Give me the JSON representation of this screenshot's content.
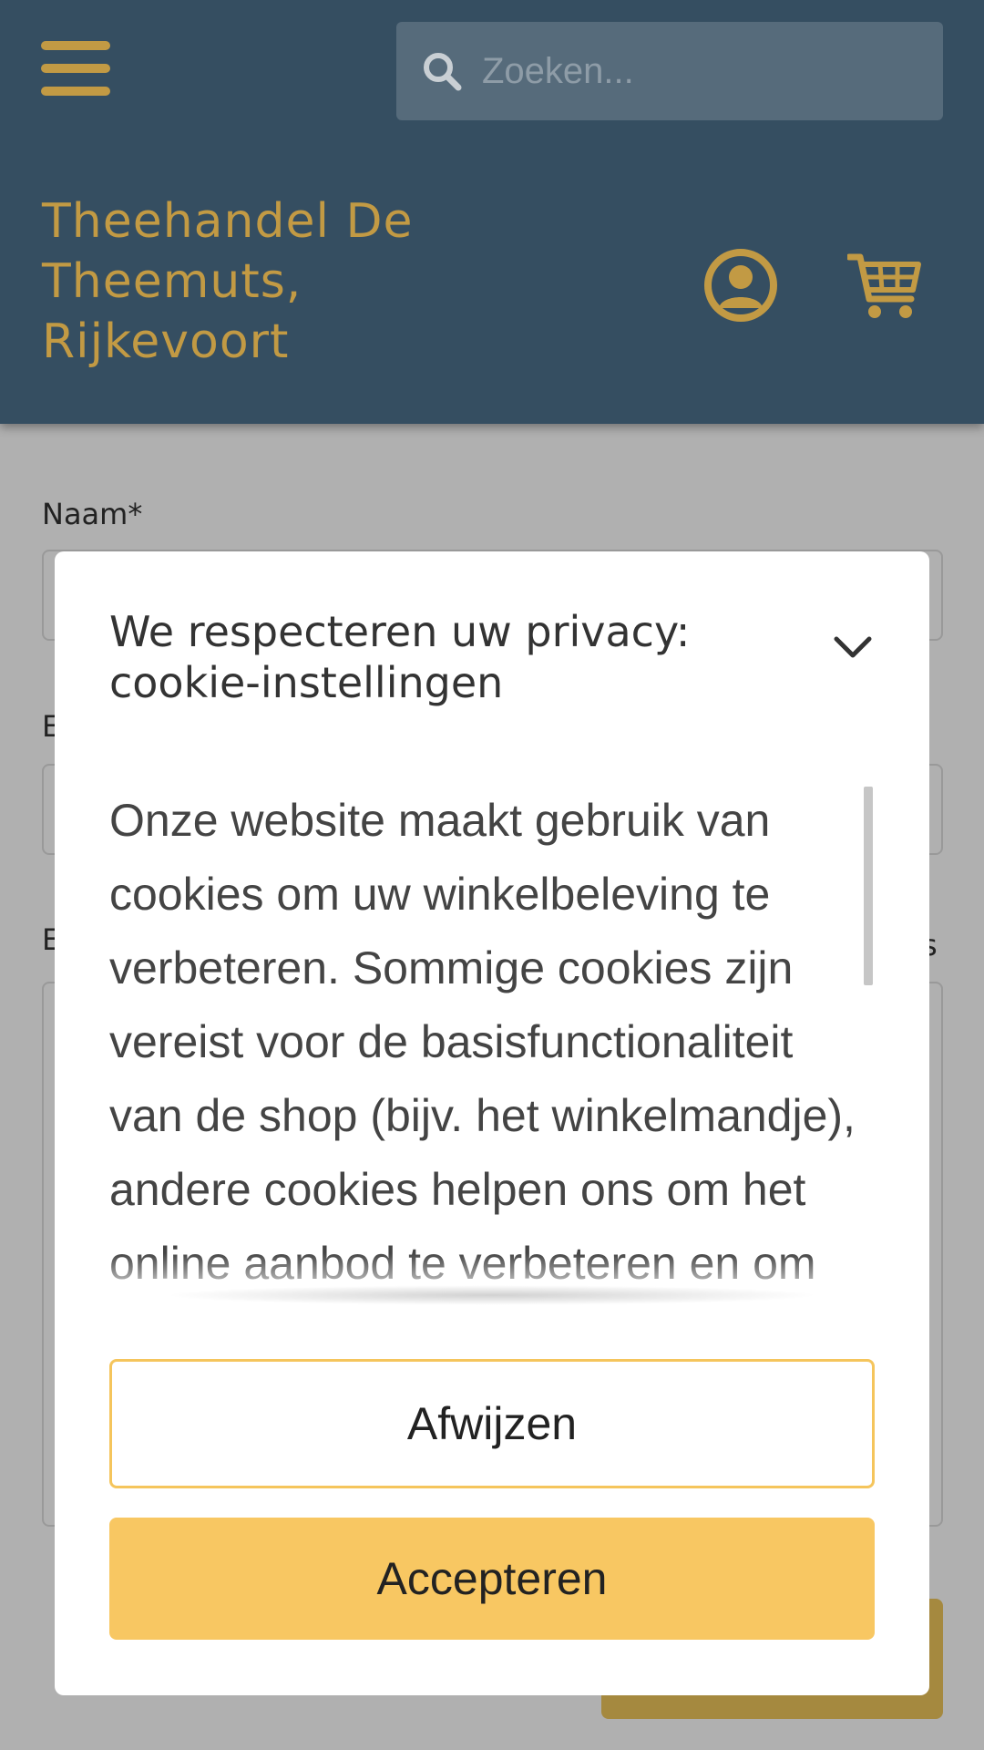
{
  "header": {
    "search_placeholder": "Zoeken...",
    "brand": "Theehandel De Theemuts, Rijkevoort",
    "accent_color": "#c29a44",
    "background_color": "#354e61",
    "icons": {
      "menu": "hamburger-menu-icon",
      "search": "search-icon",
      "account": "user-circle-icon",
      "cart": "shopping-cart-icon"
    }
  },
  "form": {
    "name_label": "Naam*",
    "label_e1": "E",
    "label_e2": "E",
    "label_s": "s"
  },
  "cookie_modal": {
    "title": "We respecteren uw privacy: cookie-instellingen",
    "body": "Onze website maakt gebruik van cookies om uw winkelbeleving te verbeteren. Sommige cookies zijn vereist voor de basisfunctionaliteit van de shop (bijv. het winkelmandje), andere cookies helpen ons om het online aanbod te verbeteren en om",
    "reject_label": "Afwijzen",
    "accept_label": "Accepteren",
    "accept_color": "#f8c762",
    "collapse_icon": "chevron-down-icon"
  }
}
